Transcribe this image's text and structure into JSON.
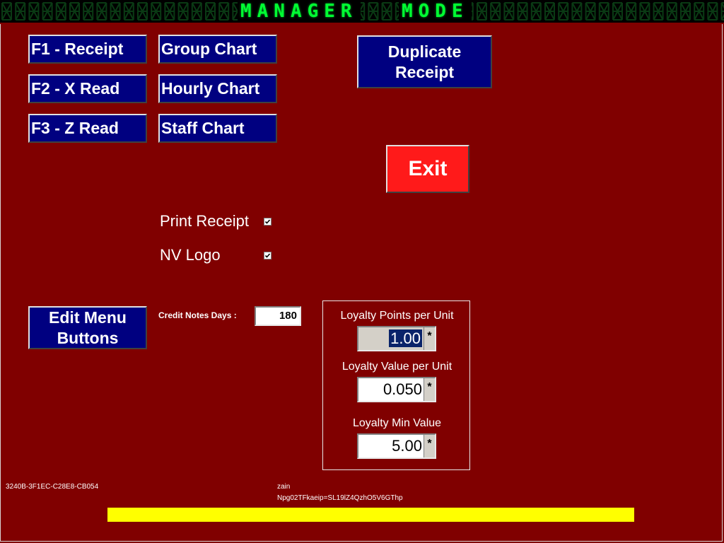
{
  "header": {
    "mode_word1": "MANAGER",
    "mode_word2": "MODE"
  },
  "buttons": {
    "f1": "F1 - Receipt",
    "f2": "F2 - X Read",
    "f3": "F3 - Z Read",
    "group_chart": "Group Chart",
    "hourly_chart": "Hourly Chart",
    "staff_chart": "Staff Chart",
    "duplicate_line1": "Duplicate",
    "duplicate_line2": "Receipt",
    "exit": "Exit",
    "edit_menu_line1": "Edit Menu",
    "edit_menu_line2": "Buttons"
  },
  "options": {
    "print_receipt": {
      "label": "Print Receipt",
      "checked": true
    },
    "nv_logo": {
      "label": "NV Logo",
      "checked": true
    }
  },
  "credit_notes": {
    "label": "Credit Notes Days :",
    "value": "180"
  },
  "loyalty": {
    "points_label": "Loyalty Points per Unit",
    "points_value": "1.00",
    "value_label": "Loyalty Value per Unit",
    "value_value": "0.050",
    "min_label": "Loyalty Min Value",
    "min_value": "5.00",
    "stepper_symbol": "*"
  },
  "footer": {
    "machine_id": "3240B-3F1EC-C28E8-CB054",
    "user": "zain",
    "license_key": "Npg02TFkaeip=SL19lZ4QzhO5V6GThp"
  },
  "colors": {
    "background": "#800000",
    "button": "#000080",
    "exit": "#ff1a1a",
    "display": "#00ff33",
    "progress": "#ffff00"
  }
}
